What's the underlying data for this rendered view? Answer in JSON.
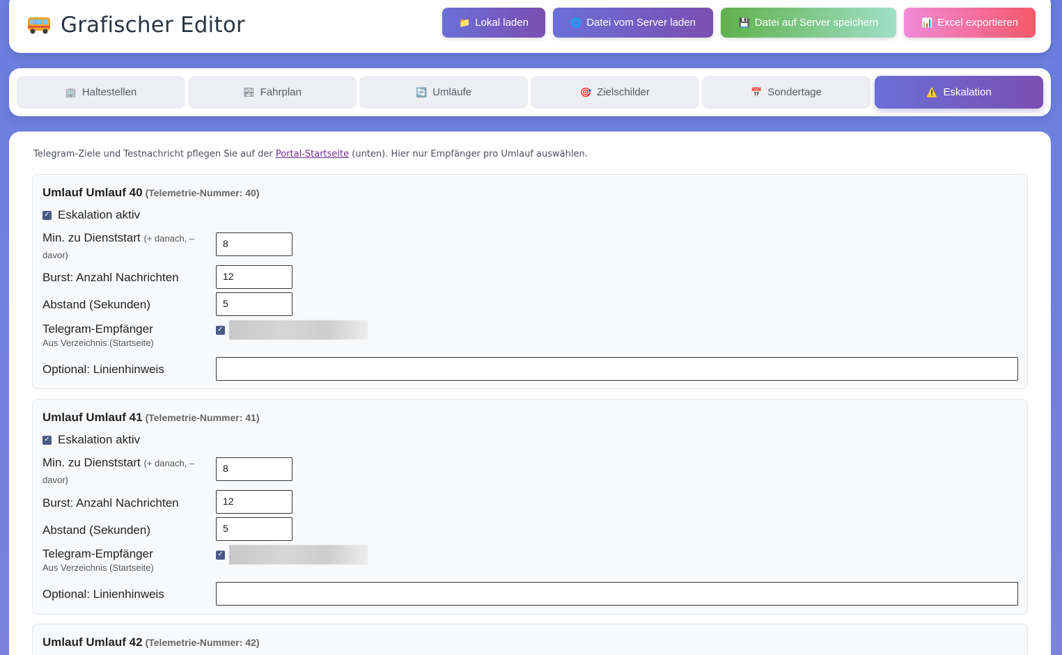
{
  "header": {
    "title": "Grafischer Editor",
    "buttons": {
      "local_load": "Lokal laden",
      "server_load": "Datei vom Server laden",
      "server_save": "Datei auf Server speichern",
      "excel_export": "Excel exportieren"
    }
  },
  "tabs": [
    {
      "label": "Haltestellen",
      "icon": "building-icon"
    },
    {
      "label": "Fahrplan",
      "icon": "picture-icon"
    },
    {
      "label": "Umläufe",
      "icon": "cycle-icon"
    },
    {
      "label": "Zielschilder",
      "icon": "target-icon"
    },
    {
      "label": "Sondertage",
      "icon": "calendar-icon"
    },
    {
      "label": "Eskalation",
      "icon": "warning-icon",
      "active": true
    }
  ],
  "intro": {
    "before": "Telegram-Ziele und Testnachricht pflegen Sie auf der ",
    "link": "Portal-Startseite",
    "after": " (unten). Hier nur Empfänger pro Umlauf auswählen."
  },
  "labels": {
    "escalation_active": "Eskalation aktiv",
    "min_to_start": "Min. zu Dienststart",
    "min_to_start_hint": "(+ danach, – davor)",
    "burst": "Burst: Anzahl Nachrichten",
    "interval": "Abstand (Sekunden)",
    "telegram_recipient": "Telegram-Empfänger",
    "telegram_recipient_sub": "Aus Verzeichnis (Startseite)",
    "line_hint": "Optional: Linienhinweis"
  },
  "umlaeufe": [
    {
      "title": "Umlauf Umlauf 40",
      "tele": "(Telemetrie-Nummer: 40)",
      "min": "8",
      "burst": "12",
      "interval": "5",
      "line_hint": ""
    },
    {
      "title": "Umlauf Umlauf 41",
      "tele": "(Telemetrie-Nummer: 41)",
      "min": "8",
      "burst": "12",
      "interval": "5",
      "line_hint": ""
    },
    {
      "title": "Umlauf Umlauf 42",
      "tele": "(Telemetrie-Nummer: 42)"
    }
  ],
  "colors": {
    "accent": "#6a6fd8",
    "accent_dark": "#7b4fb0",
    "save_green": "#5fb04a",
    "excel_pink": "#f5586a"
  }
}
